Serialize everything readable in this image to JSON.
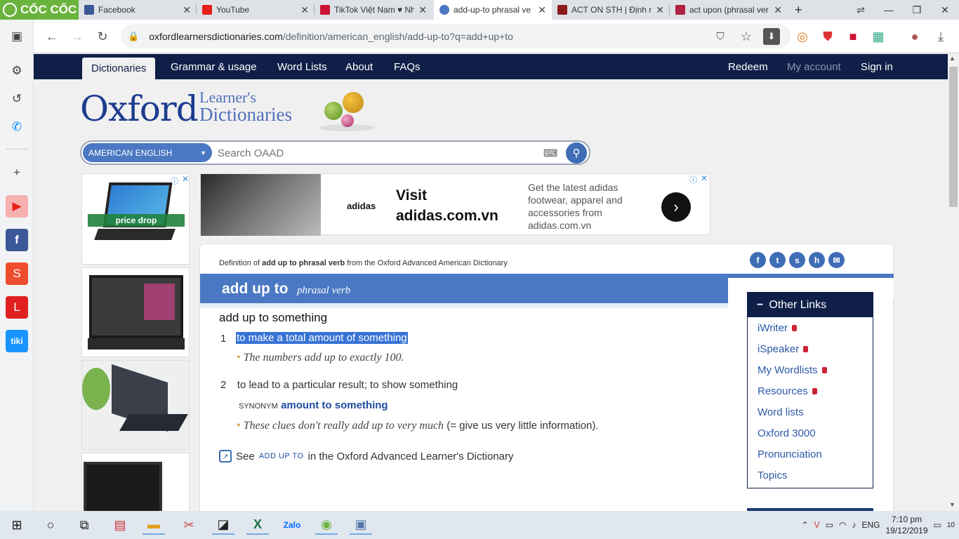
{
  "browser": {
    "brand": "CỐC CỐC",
    "tabs": [
      {
        "label": "Facebook",
        "favicon_color": "#3b5998"
      },
      {
        "label": "YouTube",
        "favicon_color": "#e62117"
      },
      {
        "label": "TikTok Việt Nam ♥ Nh",
        "favicon_color": "#cc1133"
      },
      {
        "label": "add-up-to phrasal ve",
        "favicon_color": "#4a78c2"
      },
      {
        "label": "ACT ON STH | Định n",
        "favicon_color": "#8c1c1c"
      },
      {
        "label": "act upon (phrasal ver",
        "favicon_color": "#b02040"
      }
    ],
    "url_host": "oxfordlearnersdictionaries.com",
    "url_path": "/definition/american_english/add-up-to?q=add+up+to"
  },
  "site_nav": {
    "items": [
      "Dictionaries",
      "Grammar & usage",
      "Word Lists",
      "About",
      "FAQs"
    ],
    "right": [
      "Redeem",
      "My account",
      "Sign in"
    ]
  },
  "logo": {
    "main": "Oxford",
    "line1": "Learner's",
    "line2": "Dictionaries"
  },
  "search": {
    "dictionary": "AMERICAN ENGLISH",
    "placeholder": "Search OAAD"
  },
  "ads": {
    "left_badge": "price drop",
    "banner_brand": "adidas",
    "banner_title_1": "Visit",
    "banner_title_2": "adidas.com.vn",
    "banner_desc": "Get the latest adidas footwear, apparel and accessories from adidas.com.vn"
  },
  "entry": {
    "def_prefix": "Definition of ",
    "def_word": "add up to phrasal verb",
    "def_suffix": " from the Oxford Advanced American Dictionary",
    "headword": "add up to",
    "pos": "phrasal verb",
    "phrase": "add up to something",
    "senses": [
      {
        "num": "1",
        "def": "to make a total amount of something",
        "example": "The numbers add up to exactly 100."
      },
      {
        "num": "2",
        "def": "to lead to a particular result; to show something",
        "synonym_label": "SYNONYM",
        "synonym": "amount to something",
        "example": "These clues don't really add up to very much",
        "example_gloss": " (= give us very little information)."
      }
    ],
    "see_prefix": "See ",
    "see_sc": "ADD UP TO",
    "see_suffix": " in the Oxford Advanced Learner's Dictionary"
  },
  "other_links": {
    "title": "Other Links",
    "items": [
      {
        "label": "iWriter",
        "locked": true
      },
      {
        "label": "iSpeaker",
        "locked": true
      },
      {
        "label": "My Wordlists",
        "locked": true
      },
      {
        "label": "Resources",
        "locked": true
      },
      {
        "label": "Word lists",
        "locked": false
      },
      {
        "label": "Oxford 3000",
        "locked": false
      },
      {
        "label": "Pronunciation",
        "locked": false
      },
      {
        "label": "Topics",
        "locked": false
      }
    ]
  },
  "taskbar": {
    "lang": "ENG",
    "time": "7:10 pm",
    "date": "19/12/2019",
    "notifications": "10"
  },
  "colors": {
    "nav_bg": "#0f1f48",
    "accent": "#4a78c2",
    "highlight": "#3873d6"
  }
}
